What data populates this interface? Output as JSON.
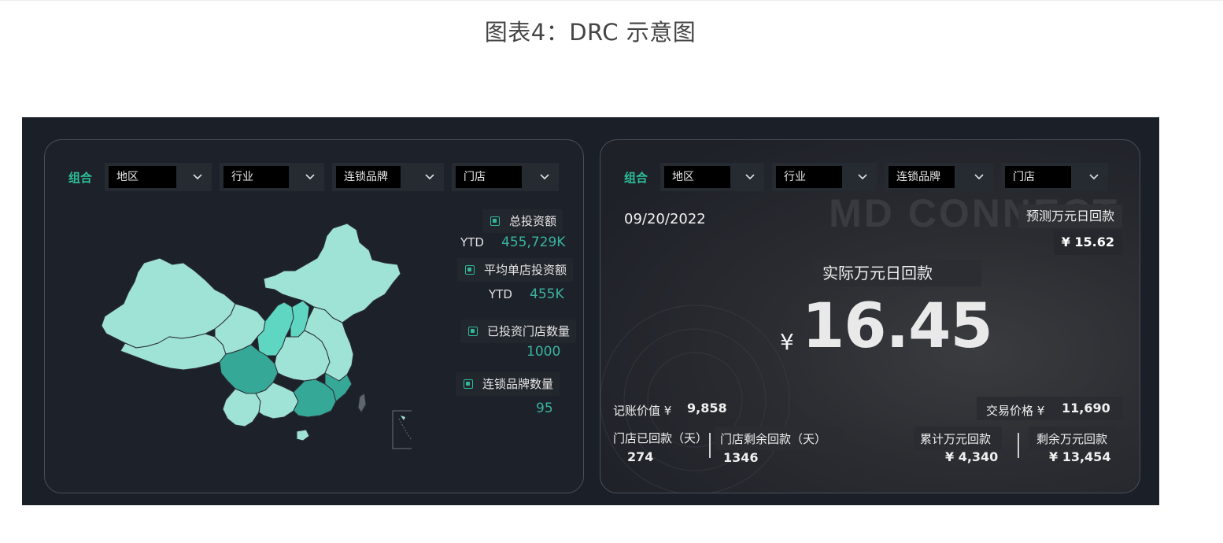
{
  "figure_title": "图表4：DRC 示意图",
  "filters": {
    "combo_label": "组合",
    "dropdowns": [
      "地区",
      "行业",
      "连锁品牌",
      "门店"
    ]
  },
  "left_panel": {
    "metrics": {
      "total_investment": {
        "label": "总投资额",
        "prefix": "YTD",
        "value": "455,729K"
      },
      "avg_investment": {
        "label": "平均单店投资额",
        "prefix": "YTD",
        "value": "455K"
      },
      "stores_invested": {
        "label": "已投资门店数量",
        "value": "1000"
      },
      "chain_brands": {
        "label": "连锁品牌数量",
        "value": "95"
      }
    }
  },
  "right_panel": {
    "watermark": "MD CONNECT",
    "date": "09/20/2022",
    "forecast": {
      "label": "预测万元日回款",
      "value": "¥ 15.62"
    },
    "actual": {
      "label": "实际万元日回款",
      "currency": "¥",
      "value": "16.45"
    },
    "book_value": {
      "label": "记账价值 ¥",
      "value": "9,858"
    },
    "trade_price": {
      "label": "交易价格 ¥",
      "value": "11,690"
    },
    "returned_days": {
      "label": "门店已回款（天）",
      "value": "274"
    },
    "remaining_days": {
      "label": "门店剩余回款（天）",
      "value": "1346"
    },
    "cumulative": {
      "label": "累计万元回款",
      "value": "¥ 4,340"
    },
    "remaining": {
      "label": "剩余万元回款",
      "value": "¥ 13,454"
    }
  },
  "colors": {
    "background": "#1b1f27",
    "accent": "#2cc09a",
    "map_light": "#9fe2d6",
    "map_mid": "#5fd6c2",
    "map_dark": "#36a897"
  }
}
